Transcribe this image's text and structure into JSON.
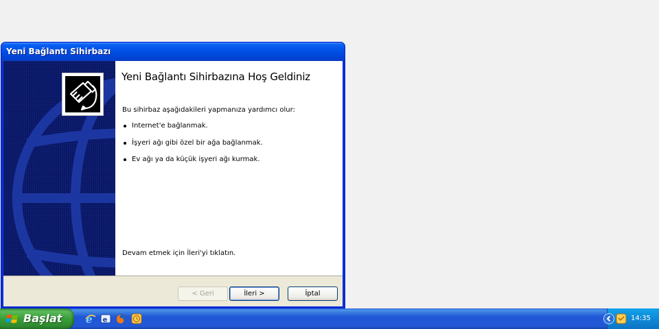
{
  "window": {
    "title": "Yeni Bağlantı Sihirbazı"
  },
  "wizard": {
    "heading": "Yeni Bağlantı Sihirbazına Hoş Geldiniz",
    "intro": "Bu sihirbaz aşağıdakileri yapmanıza yardımcı olur:",
    "bullets": [
      "Internet'e bağlanmak.",
      "İşyeri ağı gibi özel bir ağa bağlanmak.",
      "Ev ağı ya da küçük işyeri ağı kurmak."
    ],
    "footer": "Devam etmek için İleri'yi tıklatın.",
    "buttons": {
      "back": "< Geri",
      "next": "İleri >",
      "cancel": "İptal"
    }
  },
  "taskbar": {
    "start_label": "Başlat",
    "quick_launch": [
      "internet-explorer-icon",
      "outlook-express-icon",
      "firefox-icon",
      "messenger-icon"
    ],
    "tray_icons": [
      "tray-expand-icon",
      "tray-clock-app-icon"
    ],
    "clock": "14:35"
  },
  "colors": {
    "titlebar": "#0a5ff0",
    "side_panel": "#0a1866",
    "taskbar": "#2257d5",
    "start_button": "#389f38"
  }
}
